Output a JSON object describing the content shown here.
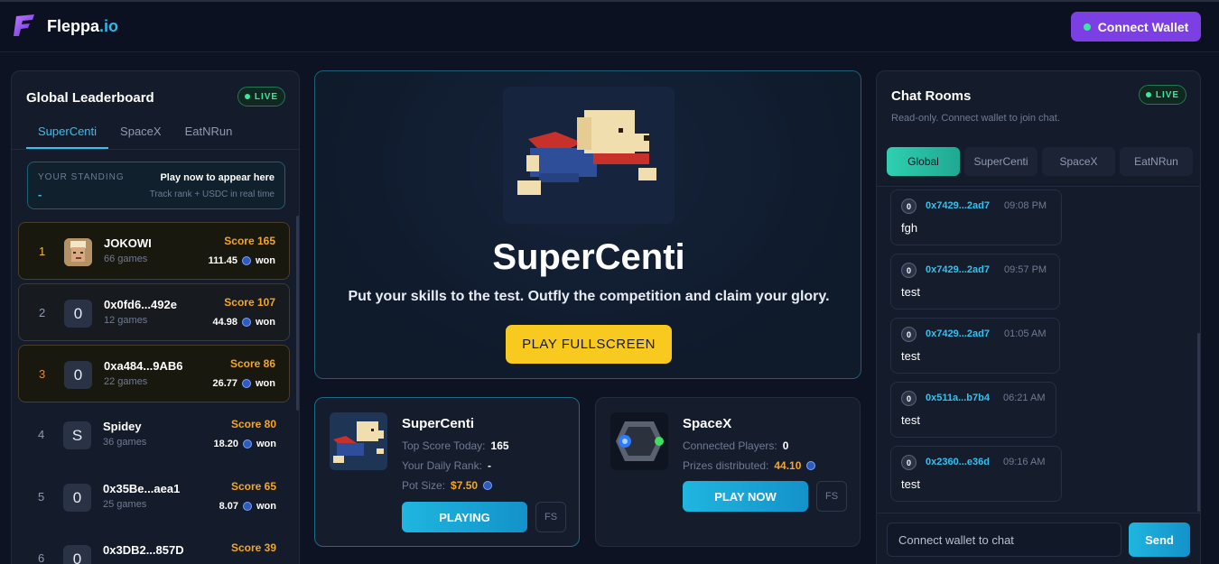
{
  "brand": {
    "name": "Fleppa",
    "suffix": ".io"
  },
  "header": {
    "connect_label": "Connect Wallet"
  },
  "leaderboard": {
    "title": "Global Leaderboard",
    "live_label": "LIVE",
    "tabs": [
      "SuperCenti",
      "SpaceX",
      "EatNRun"
    ],
    "active_tab": "SuperCenti",
    "standing": {
      "label": "YOUR STANDING",
      "value": "-",
      "cta": "Play now to appear here",
      "sub": "Track rank + USDC in real time"
    },
    "rows": [
      {
        "rank": "1",
        "avatar": "",
        "name": "JOKOWI",
        "games": "66 games",
        "score": "Score 165",
        "won": "111.45",
        "won_label": "won"
      },
      {
        "rank": "2",
        "avatar": "0",
        "name": "0x0fd6...492e",
        "games": "12 games",
        "score": "Score 107",
        "won": "44.98",
        "won_label": "won"
      },
      {
        "rank": "3",
        "avatar": "0",
        "name": "0xa484...9AB6",
        "games": "22 games",
        "score": "Score 86",
        "won": "26.77",
        "won_label": "won"
      },
      {
        "rank": "4",
        "avatar": "S",
        "name": "Spidey",
        "games": "36 games",
        "score": "Score 80",
        "won": "18.20",
        "won_label": "won"
      },
      {
        "rank": "5",
        "avatar": "0",
        "name": "0x35Be...aea1",
        "games": "25 games",
        "score": "Score 65",
        "won": "8.07",
        "won_label": "won"
      },
      {
        "rank": "6",
        "avatar": "0",
        "name": "0x3DB2...857D",
        "games": "",
        "score": "Score 39",
        "won": "",
        "won_label": ""
      }
    ]
  },
  "hero": {
    "title": "SuperCenti",
    "tagline": "Put your skills to the test. Outfly the competition and claim your glory.",
    "play_label": "PLAY FULLSCREEN"
  },
  "cards": {
    "supercenti": {
      "name": "SuperCenti",
      "line1_label": "Top Score Today:",
      "line1_value": "165",
      "line2_label": "Your Daily Rank:",
      "line2_value": "-",
      "line3_label": "Pot Size:",
      "line3_value": "$7.50",
      "button": "PLAYING",
      "fs": "FS"
    },
    "spacex": {
      "name": "SpaceX",
      "line1_label": "Connected Players:",
      "line1_value": "0",
      "line2_label": "Prizes distributed:",
      "line2_value": "44.10",
      "button": "PLAY NOW",
      "fs": "FS"
    }
  },
  "chat": {
    "title": "Chat Rooms",
    "live_label": "LIVE",
    "subtitle": "Read-only. Connect wallet to join chat.",
    "tabs": [
      "Global",
      "SuperCenti",
      "SpaceX",
      "EatNRun"
    ],
    "active_tab": "Global",
    "messages": [
      {
        "avatar": "0",
        "addr": "0x7429...2ad7",
        "time": "09:08 PM",
        "body": "fgh"
      },
      {
        "avatar": "0",
        "addr": "0x7429...2ad7",
        "time": "09:57 PM",
        "body": "test"
      },
      {
        "avatar": "0",
        "addr": "0x7429...2ad7",
        "time": "01:05 AM",
        "body": "test"
      },
      {
        "avatar": "0",
        "addr": "0x511a...b7b4",
        "time": "06:21 AM",
        "body": "test"
      },
      {
        "avatar": "0",
        "addr": "0x2360...e36d",
        "time": "09:16 AM",
        "body": "test"
      }
    ],
    "input_placeholder": "Connect wallet to chat",
    "send_label": "Send"
  }
}
